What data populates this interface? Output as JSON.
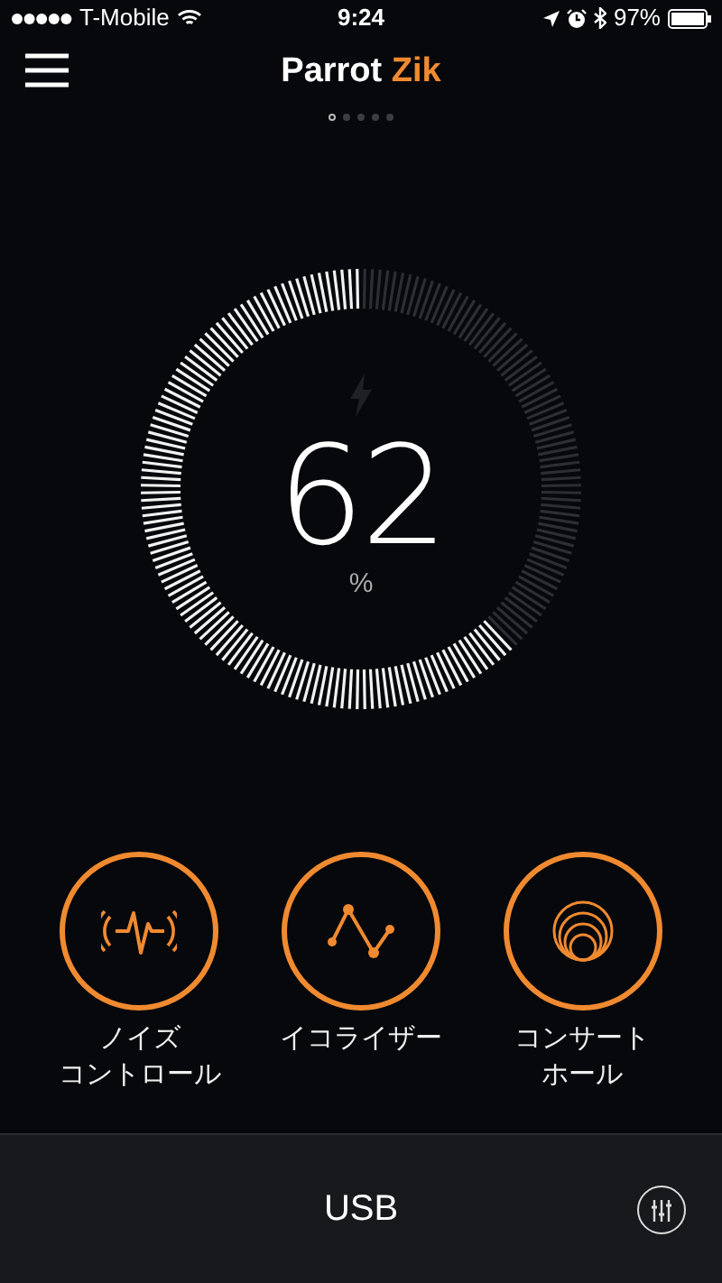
{
  "status_bar": {
    "carrier": "T-Mobile",
    "time": "9:24",
    "battery": "97%"
  },
  "header": {
    "title": "Parrot",
    "title_accent": "Zik"
  },
  "pages": [
    {
      "selected": true
    },
    {
      "selected": false
    },
    {
      "selected": false
    },
    {
      "selected": false
    },
    {
      "selected": false
    }
  ],
  "battery_gauge": {
    "reading": "62",
    "unit": "%"
  },
  "modes": [
    {
      "kind": "noise",
      "label_lines": [
        "ノイズ",
        "コントロール"
      ]
    },
    {
      "kind": "equalizer",
      "label_lines": [
        "イコライザー"
      ]
    },
    {
      "kind": "concert",
      "label_lines": [
        "コンサート",
        "ホール"
      ]
    }
  ],
  "footer": {
    "source": "USB"
  }
}
